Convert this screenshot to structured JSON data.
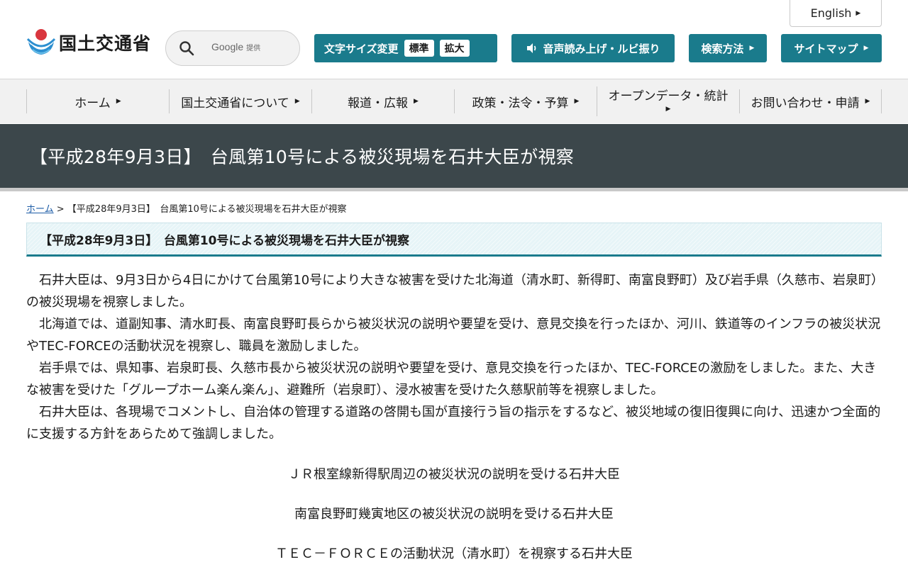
{
  "header": {
    "english_label": "English",
    "logo_text": "国土交通省",
    "search": {
      "google_label": "Google",
      "provided_label": "提供"
    },
    "font_size": {
      "label": "文字サイズ変更",
      "standard": "標準",
      "enlarge": "拡大"
    },
    "voice_label": "音声読み上げ・ルビ振り",
    "search_method_label": "検索方法",
    "sitemap_label": "サイトマップ"
  },
  "nav": {
    "items": [
      {
        "label": "ホーム"
      },
      {
        "label": "国土交通省について"
      },
      {
        "label": "報道・広報"
      },
      {
        "label": "政策・法令・予算"
      },
      {
        "label": "オープンデータ・統計"
      },
      {
        "label": "お問い合わせ・申請"
      }
    ]
  },
  "banner": {
    "title": "【平成28年9月3日】　台風第10号による被災現場を石井大臣が視察"
  },
  "breadcrumb": {
    "home": "ホーム",
    "separator": " > ",
    "current": "【平成28年9月3日】　台風第10号による被災現場を石井大臣が視察"
  },
  "section_title": "【平成28年9月3日】　台風第10号による被災現場を石井大臣が視察",
  "paragraphs": [
    "石井大臣は、9月3日から4日にかけて台風第10号により大きな被害を受けた北海道（清水町、新得町、南富良野町）及び岩手県（久慈市、岩泉町）の被災現場を視察しました。",
    "　北海道では、道副知事、清水町長、南富良野町長らから被災状況の説明や要望を受け、意見交換を行ったほか、河川、鉄道等のインフラの被災状況やTEC-FORCEの活動状況を視察し、職員を激励しました。",
    "　岩手県では、県知事、岩泉町長、久慈市長から被災状況の説明や要望を受け、意見交換を行ったほか、TEC-FORCEの激励をしました。また、大きな被害を受けた「グループホーム楽ん楽ん」、避難所（岩泉町）、浸水被害を受けた久慈駅前等を視察しました。",
    "　石井大臣は、各現場でコメントし、自治体の管理する道路の啓開も国が直接行う旨の指示をするなど、被災地域の復旧復興に向け、迅速かつ全面的に支援する方針をあらためて強調しました。"
  ],
  "captions": [
    "ＪＲ根室線新得駅周辺の被災状況の説明を受ける石井大臣",
    "南富良野町幾寅地区の被災状況の説明を受ける石井大臣",
    "ＴＥＣ－ＦＯＲＣＥの活動状況（清水町）を視察する石井大臣"
  ],
  "colors": {
    "accent": "#1a7b8c",
    "banner": "#3c474b",
    "nav_bg": "#f1f1f1",
    "link": "#1b5ba6"
  },
  "icons": [
    "mlit-logo-icon",
    "search-icon",
    "speaker-icon",
    "triangle-right-icon"
  ]
}
